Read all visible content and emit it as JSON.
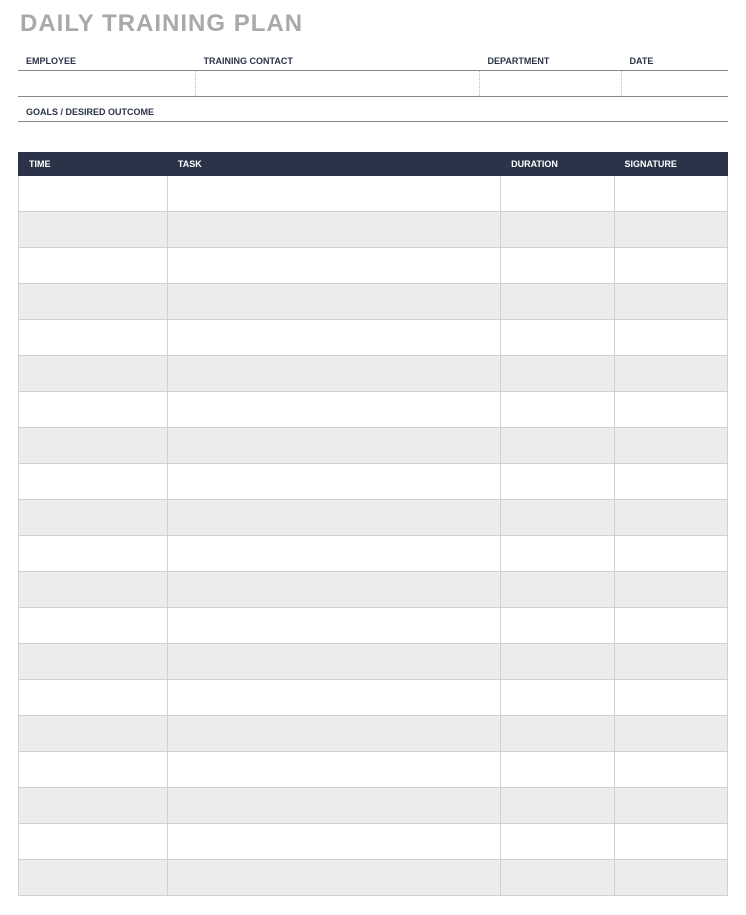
{
  "title": "DAILY TRAINING PLAN",
  "info": {
    "employee_label": "EMPLOYEE",
    "contact_label": "TRAINING CONTACT",
    "department_label": "DEPARTMENT",
    "date_label": "DATE",
    "employee_value": "",
    "contact_value": "",
    "department_value": "",
    "date_value": "",
    "goals_label": "GOALS / DESIRED OUTCOME",
    "goals_value": ""
  },
  "schedule": {
    "headers": {
      "time": "TIME",
      "task": "TASK",
      "duration": "DURATION",
      "signature": "SIGNATURE"
    },
    "rows": [
      {
        "time": "",
        "task": "",
        "duration": "",
        "signature": ""
      },
      {
        "time": "",
        "task": "",
        "duration": "",
        "signature": ""
      },
      {
        "time": "",
        "task": "",
        "duration": "",
        "signature": ""
      },
      {
        "time": "",
        "task": "",
        "duration": "",
        "signature": ""
      },
      {
        "time": "",
        "task": "",
        "duration": "",
        "signature": ""
      },
      {
        "time": "",
        "task": "",
        "duration": "",
        "signature": ""
      },
      {
        "time": "",
        "task": "",
        "duration": "",
        "signature": ""
      },
      {
        "time": "",
        "task": "",
        "duration": "",
        "signature": ""
      },
      {
        "time": "",
        "task": "",
        "duration": "",
        "signature": ""
      },
      {
        "time": "",
        "task": "",
        "duration": "",
        "signature": ""
      },
      {
        "time": "",
        "task": "",
        "duration": "",
        "signature": ""
      },
      {
        "time": "",
        "task": "",
        "duration": "",
        "signature": ""
      },
      {
        "time": "",
        "task": "",
        "duration": "",
        "signature": ""
      },
      {
        "time": "",
        "task": "",
        "duration": "",
        "signature": ""
      },
      {
        "time": "",
        "task": "",
        "duration": "",
        "signature": ""
      },
      {
        "time": "",
        "task": "",
        "duration": "",
        "signature": ""
      },
      {
        "time": "",
        "task": "",
        "duration": "",
        "signature": ""
      },
      {
        "time": "",
        "task": "",
        "duration": "",
        "signature": ""
      },
      {
        "time": "",
        "task": "",
        "duration": "",
        "signature": ""
      },
      {
        "time": "",
        "task": "",
        "duration": "",
        "signature": ""
      }
    ]
  }
}
